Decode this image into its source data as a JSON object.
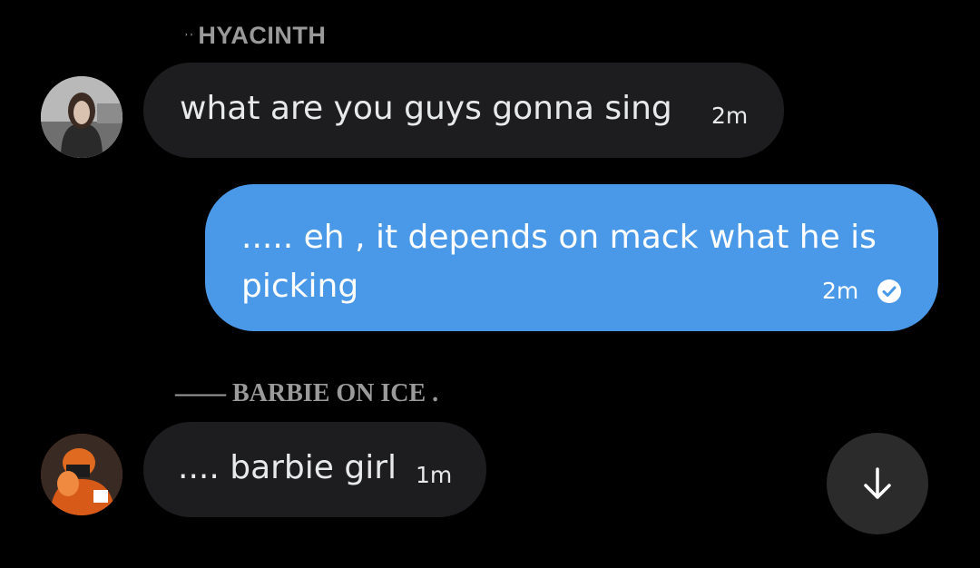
{
  "conversation": {
    "groups": [
      {
        "sender": {
          "prefix": "˒˒",
          "name": "HYACINTH"
        },
        "messages": [
          {
            "text": "what are you guys gonna sing",
            "time": "2m"
          }
        ]
      },
      {
        "outgoing": true,
        "messages": [
          {
            "text": "..... eh , it depends on mack what he is picking",
            "time": "2m",
            "status_icon": "check-circle-icon"
          }
        ]
      },
      {
        "sender": {
          "name": "—— BARBIE ON ICE ."
        },
        "messages": [
          {
            "text": ".... barbie girl",
            "time": "1m"
          }
        ]
      }
    ]
  },
  "scroll_button": {
    "icon": "arrow-down-icon"
  },
  "colors": {
    "background": "#000000",
    "incoming_bubble": "#1d1d1f",
    "outgoing_bubble": "#4a99e9",
    "sender_name": "#9a9a9a",
    "scroll_button": "#2b2b2b"
  }
}
